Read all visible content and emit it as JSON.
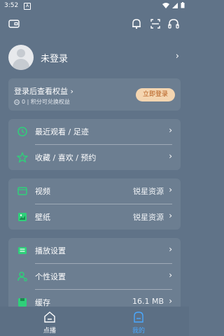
{
  "status": {
    "time": "3:52",
    "notification": "A"
  },
  "profile": {
    "login_status": "未登录"
  },
  "benefits": {
    "title": "登录后查看权益",
    "subtitle": "0 | 积分可兑换权益",
    "login_button": "立即登录"
  },
  "group1": [
    {
      "label": "最近观看 / 足迹",
      "icon": "clock-icon"
    },
    {
      "label": "收藏 / 喜欢 / 预约",
      "icon": "star-icon"
    }
  ],
  "group2": [
    {
      "label": "视频",
      "value": "锐星资源",
      "icon": "video-icon"
    },
    {
      "label": "壁纸",
      "value": "锐星资源",
      "icon": "wallpaper-icon"
    }
  ],
  "group3": [
    {
      "label": "播放设置",
      "icon": "play-settings-icon"
    },
    {
      "label": "个性设置",
      "icon": "personal-settings-icon"
    },
    {
      "label": "缓存",
      "value": "16.1 MB",
      "icon": "cache-icon"
    }
  ],
  "nav": [
    {
      "label": "点播",
      "icon": "home-icon",
      "active": false
    },
    {
      "label": "我的",
      "icon": "mine-icon",
      "active": true
    }
  ],
  "colors": {
    "accent_green": "#2fd07a",
    "button_bg": "#f4d5b0",
    "button_text": "#b35a1b",
    "nav_active": "#4aa8ff"
  }
}
